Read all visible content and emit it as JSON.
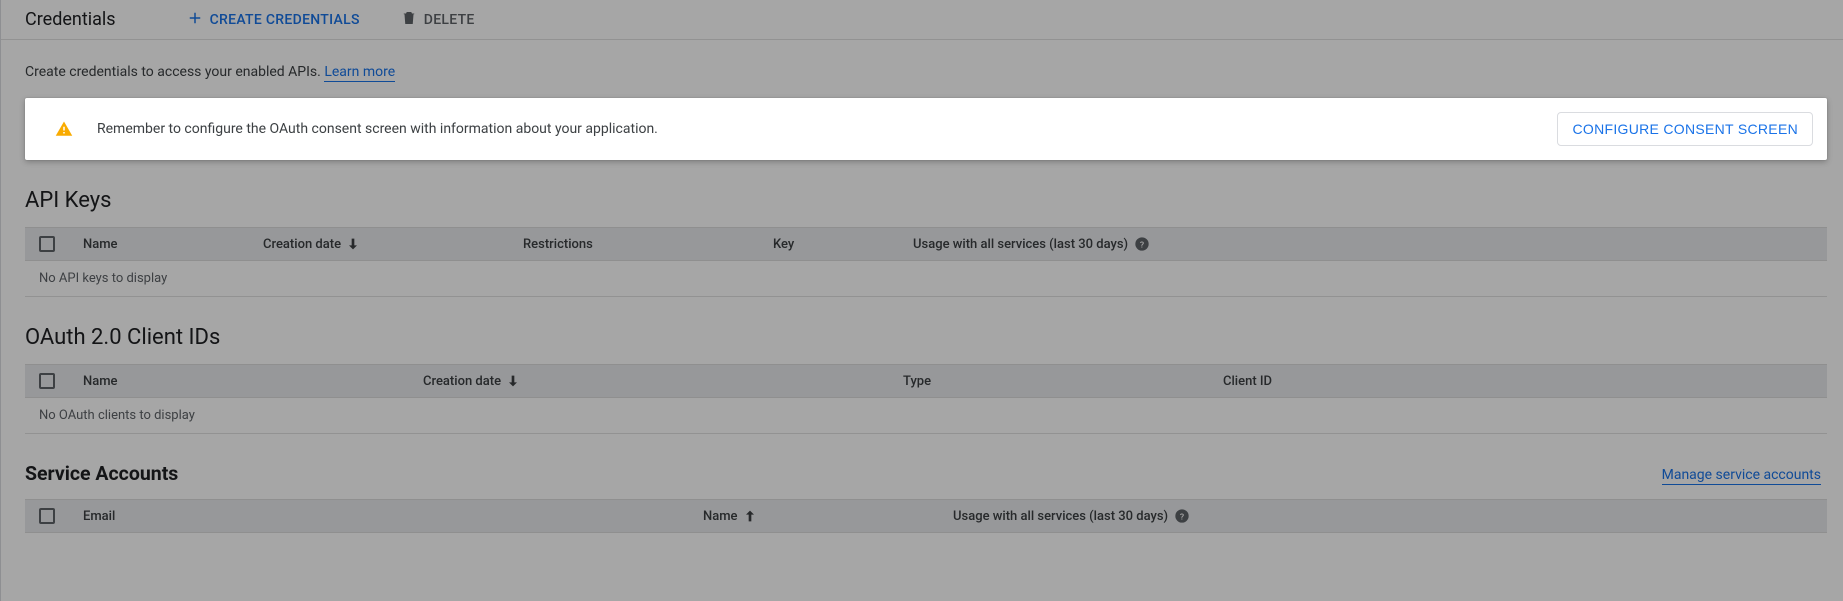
{
  "toolbar": {
    "title": "Credentials",
    "create_label": "Create Credentials",
    "delete_label": "Delete"
  },
  "intro": {
    "text": "Create credentials to access your enabled APIs. ",
    "link": "Learn more"
  },
  "alert": {
    "message": "Remember to configure the OAuth consent screen with information about your application.",
    "button": "Configure Consent Screen"
  },
  "sections": {
    "api_keys": {
      "title": "API Keys",
      "headers": {
        "name": "Name",
        "creation": "Creation date",
        "restrictions": "Restrictions",
        "key": "Key",
        "usage": "Usage with all services (last 30 days)"
      },
      "empty": "No API keys to display"
    },
    "oauth": {
      "title": "OAuth 2.0 Client IDs",
      "headers": {
        "name": "Name",
        "creation": "Creation date",
        "type": "Type",
        "client_id": "Client ID"
      },
      "empty": "No OAuth clients to display"
    },
    "service_accounts": {
      "title": "Service Accounts",
      "manage_link": "Manage service accounts",
      "headers": {
        "email": "Email",
        "name": "Name",
        "usage": "Usage with all services (last 30 days)"
      }
    }
  }
}
